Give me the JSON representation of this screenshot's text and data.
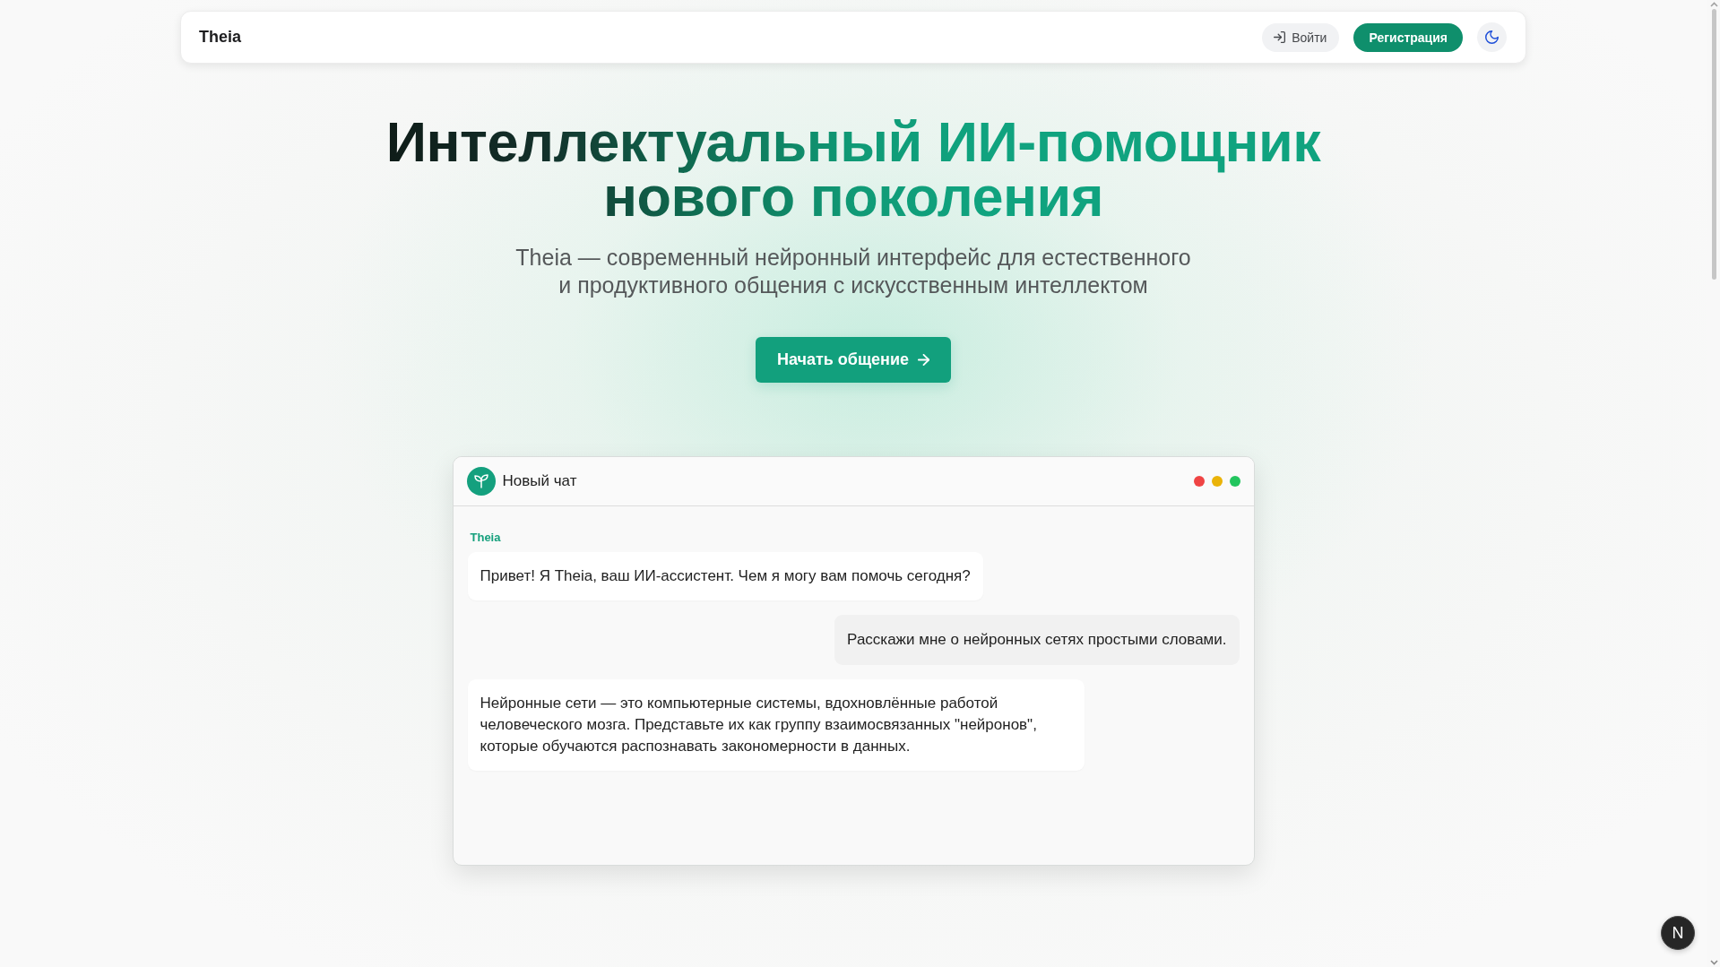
{
  "header": {
    "brand": "Theia",
    "login_button": "Войти",
    "signup_button": "Регистрация"
  },
  "hero": {
    "title": "Интеллектуальный ИИ-помощник нового поколения",
    "subtitle": "Theia — современный нейронный интерфейс для естественного и продуктивного общения с искусственным интеллектом",
    "cta_button": "Начать общение"
  },
  "chat": {
    "title": "Новый чат",
    "window_dots": [
      {
        "color": "#ef4444"
      },
      {
        "color": "#eab308"
      },
      {
        "color": "#22c55e"
      }
    ],
    "messages": [
      {
        "kind": "assistant",
        "sender": "Theia",
        "text": "Привет! Я Theia, ваш ИИ-ассистент. Чем я могу вам помочь сегодня?"
      },
      {
        "kind": "user",
        "text": "Расскажи мне о нейронных сетях простыми словами."
      },
      {
        "kind": "assistant",
        "text": "Нейронные сети — это компьютерные системы, вдохновлённые работой человеческого мозга. Представьте их как группу взаимосвязанных \"нейронов\", которые обучаются распознавать закономерности в данных."
      }
    ]
  },
  "dev_badge": {
    "label": "N"
  }
}
